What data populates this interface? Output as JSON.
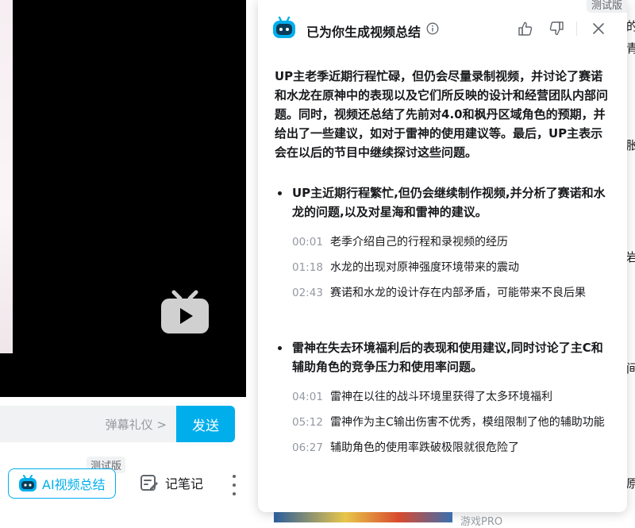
{
  "danmaku": {
    "etiquette_label": "弹幕礼仪 >",
    "send_label": "发送"
  },
  "toolbar": {
    "test_badge": "测试版",
    "ai_summary_label": "AI视频总结",
    "notes_label": "记笔记"
  },
  "panel": {
    "test_badge": "测试版",
    "title": "已为你生成视频总结",
    "summary": "UP主老季近期行程忙碌，但仍会尽量录制视频，并讨论了赛诺和水龙在原神中的表现以及它们所反映的设计和经营团队内部问题。同时，视频还总结了先前对4.0和枫丹区域角色的预期，并给出了一些建议，如对于雷神的使用建议等。最后，UP主表示会在以后的节目中继续探讨这些问题。",
    "sections": [
      {
        "title": "UP主近期行程繁忙,但仍会继续制作视频,并分析了赛诺和水龙的问题,以及对星海和雷神的建议。",
        "items": [
          {
            "time": "00:01",
            "text": "老季介绍自己的行程和录视频的经历"
          },
          {
            "time": "01:18",
            "text": "水龙的出现对原神强度环境带来的震动"
          },
          {
            "time": "02:43",
            "text": "赛诺和水龙的设计存在内部矛盾，可能带来不良后果"
          }
        ]
      },
      {
        "title": "雷神在失去环境福利后的表现和使用建议,同时讨论了主C和辅助角色的竞争压力和使用率问题。",
        "items": [
          {
            "time": "04:01",
            "text": "雷神在以往的战斗环境里获得了太多环境福利"
          },
          {
            "time": "05:12",
            "text": "雷神作为主C输出伤害不优秀，模组限制了他的辅助功能"
          },
          {
            "time": "06:27",
            "text": "辅助角色的使用率跌破极限就很危险了"
          }
        ]
      }
    ]
  },
  "right_edge": {
    "fragments": [
      "的",
      "青",
      "胀",
      "岩",
      "间",
      "原"
    ]
  },
  "bottom": {
    "peek_text": "游戏PRO"
  },
  "colors": {
    "accent": "#00aeec",
    "player_bg": "#000000",
    "logo_gray": "#d0d0d0"
  }
}
